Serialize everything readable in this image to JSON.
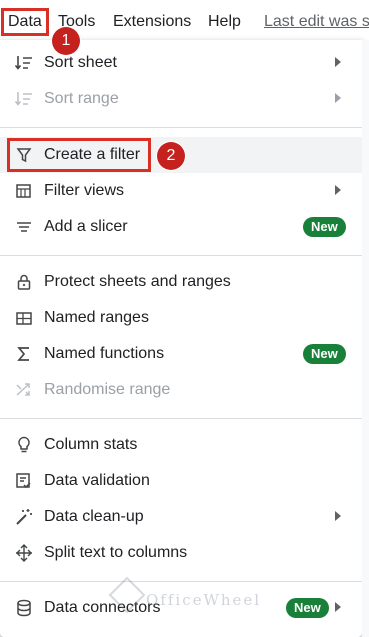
{
  "menubar": {
    "data": "Data",
    "tools": "Tools",
    "extensions": "Extensions",
    "help": "Help",
    "last_edit": "Last edit was s"
  },
  "callouts": {
    "one": "1",
    "two": "2"
  },
  "menu": {
    "items": [
      {
        "label": "Sort sheet",
        "icon": "sort-icon",
        "submenu": true
      },
      {
        "label": "Sort range",
        "icon": "sort-range-icon",
        "submenu": true,
        "disabled": true
      },
      {
        "label": "Create a filter",
        "icon": "filter-icon"
      },
      {
        "label": "Filter views",
        "icon": "filter-views-icon",
        "submenu": true
      },
      {
        "label": "Add a slicer",
        "icon": "slicer-icon",
        "badge": "New"
      },
      {
        "label": "Protect sheets and ranges",
        "icon": "lock-icon"
      },
      {
        "label": "Named ranges",
        "icon": "named-ranges-icon"
      },
      {
        "label": "Named functions",
        "icon": "sigma-icon",
        "badge": "New"
      },
      {
        "label": "Randomise range",
        "icon": "shuffle-icon",
        "disabled": true
      },
      {
        "label": "Column stats",
        "icon": "lightbulb-icon"
      },
      {
        "label": "Data validation",
        "icon": "validation-icon"
      },
      {
        "label": "Data clean-up",
        "icon": "magic-wand-icon",
        "submenu": true
      },
      {
        "label": "Split text to columns",
        "icon": "split-icon"
      },
      {
        "label": "Data connectors",
        "icon": "database-icon",
        "badge": "New",
        "submenu": true
      }
    ]
  },
  "watermark": "OfficeWheel",
  "colors": {
    "highlight_border": "#d93025",
    "callout": "#c5221f",
    "new_badge": "#188038",
    "hover": "#f1f3f4"
  }
}
